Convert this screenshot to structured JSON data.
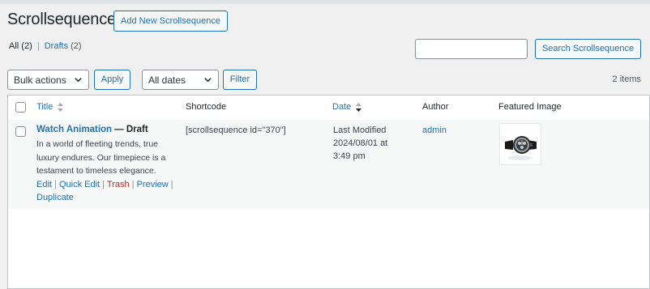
{
  "page": {
    "title": "Scrollsequence",
    "add_new_label": "Add New Scrollsequence"
  },
  "views": {
    "all_label": "All",
    "all_count": "(2)",
    "separator": "|",
    "drafts_label": "Drafts",
    "drafts_count": "(2)"
  },
  "search": {
    "value": "",
    "button_label": "Search Scrollsequence"
  },
  "toolbar": {
    "bulk_actions": "Bulk actions",
    "apply_label": "Apply",
    "dates": "All dates",
    "filter_label": "Filter",
    "items_count": "2 items"
  },
  "table": {
    "columns": {
      "title": "Title",
      "shortcode": "Shortcode",
      "date": "Date",
      "author": "Author",
      "featured_image": "Featured Image"
    },
    "rows": [
      {
        "title": "Watch Animation",
        "state": "— Draft",
        "excerpt": "In a world of fleeting trends, true luxury endures. Our timepiece is a testament to timeless elegance.",
        "actions": {
          "edit": "Edit",
          "quick_edit": "Quick Edit",
          "trash": "Trash",
          "preview": "Preview",
          "duplicate": "Duplicate",
          "sep": "|"
        },
        "shortcode": "[scrollsequence id=\"370\"]",
        "date_status": "Last Modified",
        "date_value": "2024/08/01 at",
        "date_time": "3:49 pm",
        "author": "admin",
        "featured_image": "watch-thumbnail"
      }
    ]
  },
  "colors": {
    "link": "#2271b1",
    "trash": "#b32d2e",
    "background": "#f0f0f1"
  }
}
